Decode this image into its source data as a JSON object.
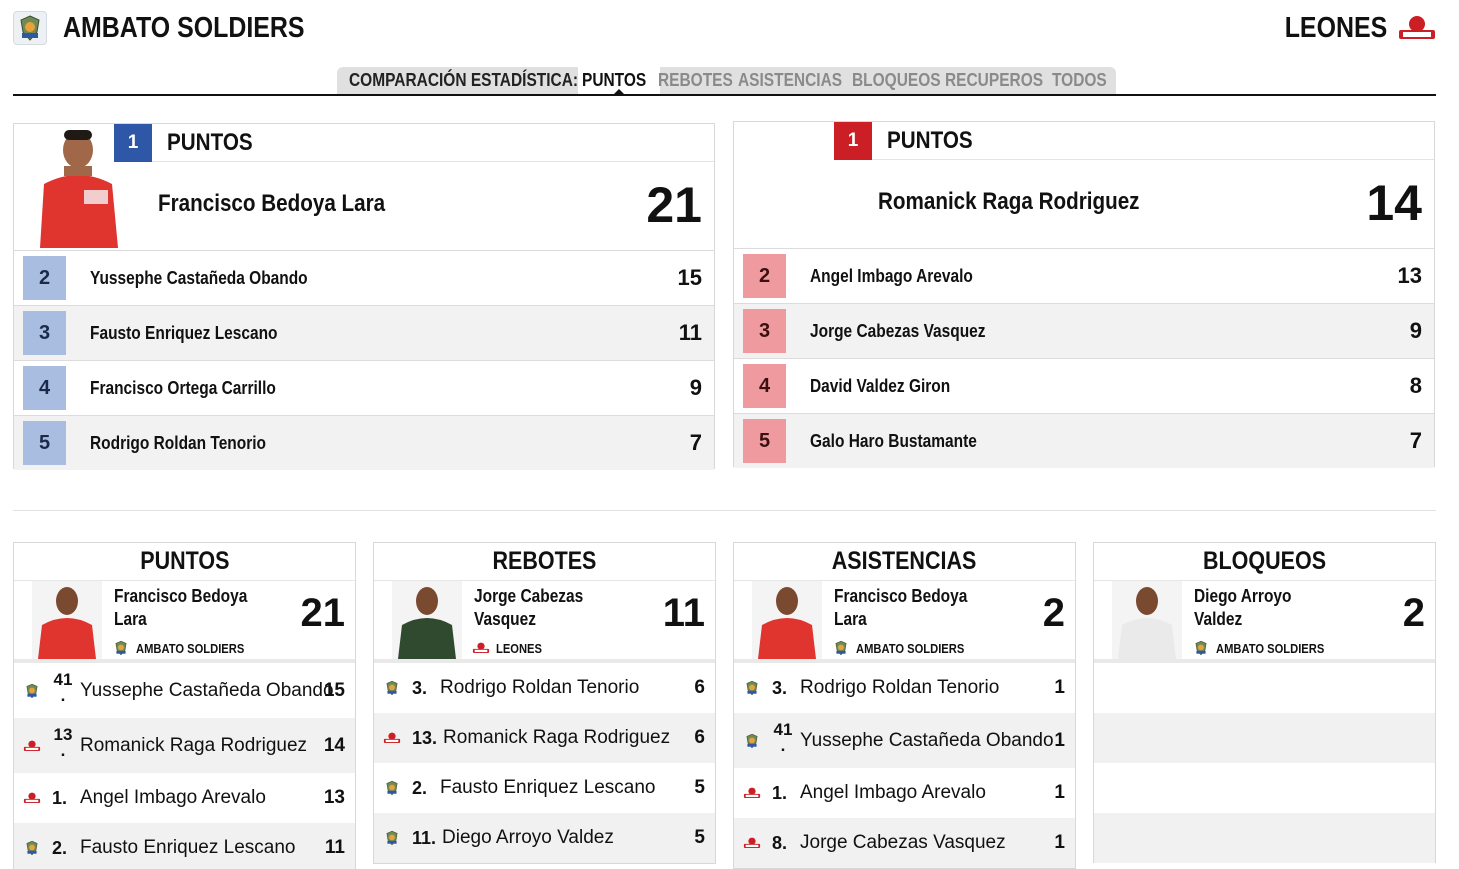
{
  "header": {
    "home_team": "AMBATO SOLDIERS",
    "away_team": "LEONES",
    "compare_label": "COMPARACIÓN ESTADÍSTICA:",
    "tabs": [
      "PUNTOS",
      "REBOTES",
      "ASISTENCIAS",
      "BLOQUEOS",
      "RECUPEROS",
      "TODOS"
    ],
    "active_tab": "PUNTOS"
  },
  "colors": {
    "home_accent": "#2e57a8",
    "away_accent": "#cc1e25",
    "home_rank": "#a9bde0",
    "away_rank": "#ef9a9e"
  },
  "home_leader": {
    "rank": "1",
    "category": "PUNTOS",
    "name": "Francisco Bedoya Lara",
    "value": "21",
    "rows": [
      {
        "rank": "2",
        "name": "Yussephe Castañeda Obando",
        "value": "15"
      },
      {
        "rank": "3",
        "name": "Fausto Enriquez Lescano",
        "value": "11"
      },
      {
        "rank": "4",
        "name": "Francisco Ortega Carrillo",
        "value": "9"
      },
      {
        "rank": "5",
        "name": "Rodrigo Roldan Tenorio",
        "value": "7"
      }
    ]
  },
  "away_leader": {
    "rank": "1",
    "category": "PUNTOS",
    "name": "Romanick Raga Rodriguez",
    "value": "14",
    "rows": [
      {
        "rank": "2",
        "name": "Angel Imbago Arevalo",
        "value": "13"
      },
      {
        "rank": "3",
        "name": "Jorge Cabezas Vasquez",
        "value": "9"
      },
      {
        "rank": "4",
        "name": "David Valdez Giron",
        "value": "8"
      },
      {
        "rank": "5",
        "name": "Galo Haro Bustamante",
        "value": "7"
      }
    ]
  },
  "categories": [
    {
      "title": "PUNTOS",
      "leader_name_1": "Francisco Bedoya",
      "leader_name_2": "Lara",
      "leader_team": "AMBATO SOLDIERS",
      "leader_value": "21",
      "rows": [
        {
          "num_a": "41",
          "num_b": ".",
          "name": "Yussephe Castañeda Obando",
          "value": "15",
          "team": "soldiers"
        },
        {
          "num_a": "13",
          "num_b": ".",
          "name": "Romanick Raga Rodriguez",
          "value": "14",
          "team": "leones"
        },
        {
          "num_a": "1.",
          "num_b": "",
          "name": "Angel Imbago Arevalo",
          "value": "13",
          "team": "leones"
        },
        {
          "num_a": "2.",
          "num_b": "",
          "name": "Fausto Enriquez Lescano",
          "value": "11",
          "team": "soldiers"
        }
      ]
    },
    {
      "title": "REBOTES",
      "leader_name_1": "Jorge Cabezas",
      "leader_name_2": "Vasquez",
      "leader_team": "LEONES",
      "leader_value": "11",
      "rows": [
        {
          "num_a": "3.",
          "name": "Rodrigo Roldan Tenorio",
          "value": "6",
          "team": "soldiers"
        },
        {
          "num_a": "13.",
          "name": "Romanick Raga Rodriguez",
          "value": "6",
          "team": "leones"
        },
        {
          "num_a": "2.",
          "name": "Fausto Enriquez Lescano",
          "value": "5",
          "team": "soldiers"
        },
        {
          "num_a": "11.",
          "name": "Diego Arroyo Valdez",
          "value": "5",
          "team": "soldiers"
        }
      ]
    },
    {
      "title": "ASISTENCIAS",
      "leader_name_1": "Francisco Bedoya",
      "leader_name_2": "Lara",
      "leader_team": "AMBATO SOLDIERS",
      "leader_value": "2",
      "rows": [
        {
          "num_a": "3.",
          "num_b": "",
          "name": "Rodrigo Roldan Tenorio",
          "value": "1",
          "team": "soldiers"
        },
        {
          "num_a": "41",
          "num_b": ".",
          "name": "Yussephe Castañeda Obando",
          "value": "1",
          "team": "soldiers"
        },
        {
          "num_a": "1.",
          "num_b": "",
          "name": "Angel Imbago Arevalo",
          "value": "1",
          "team": "leones"
        },
        {
          "num_a": "8.",
          "num_b": "",
          "name": "Jorge Cabezas Vasquez",
          "value": "1",
          "team": "leones"
        }
      ]
    },
    {
      "title": "BLOQUEOS",
      "leader_name_1": "Diego Arroyo",
      "leader_name_2": "Valdez",
      "leader_team": "AMBATO SOLDIERS",
      "leader_value": "2",
      "rows": []
    }
  ]
}
